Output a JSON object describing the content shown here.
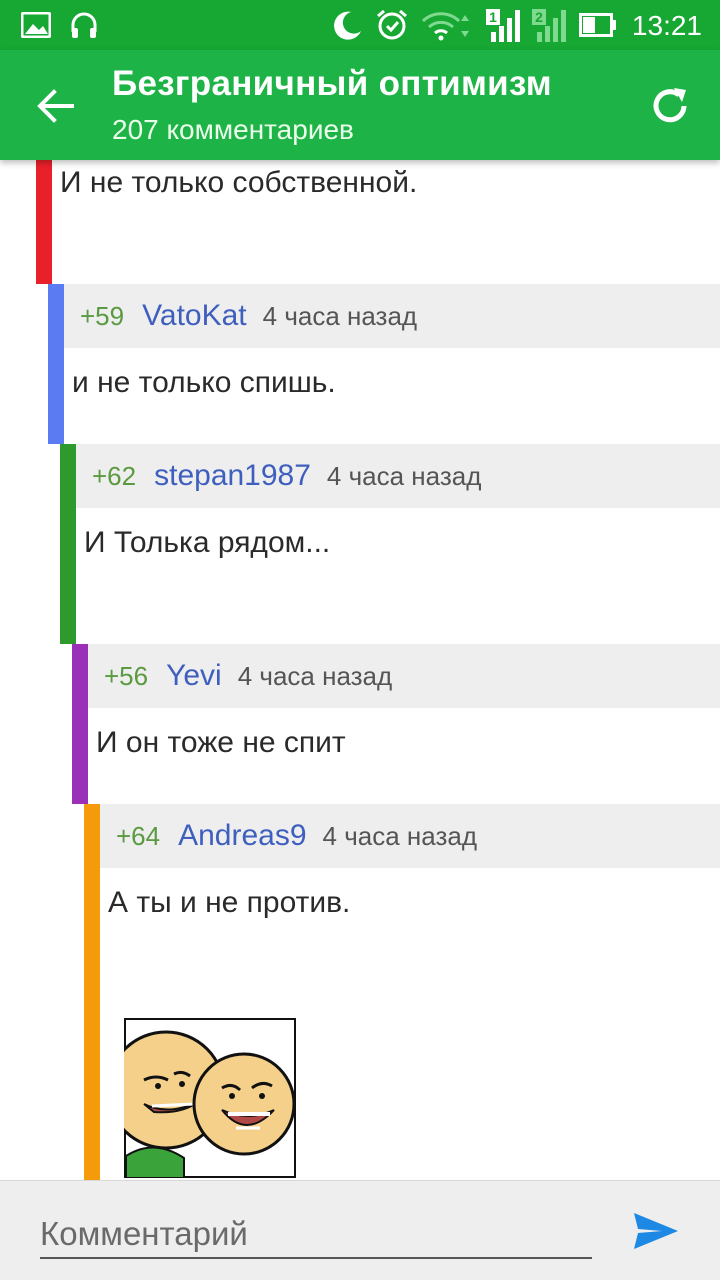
{
  "status_bar": {
    "time": "13:21",
    "icons": [
      "gallery-icon",
      "headphones-icon",
      "moon-icon",
      "alarm-icon",
      "wifi-icon",
      "signal-sim1-icon",
      "signal-sim2-icon",
      "battery-icon"
    ],
    "sim1_label": "1",
    "sim2_label": "2"
  },
  "app_bar": {
    "title": "Безграничный оптимизм",
    "subtitle": "207 комментариев",
    "color": "#1db347"
  },
  "comments": [
    {
      "text": "И не только собственной.",
      "bar_color": "#e8202a"
    },
    {
      "score": "+59",
      "author": "VatoKat",
      "time": "4 часа назад",
      "text": "и не только спишь.",
      "bar_color": "#5a7bf2"
    },
    {
      "score": "+62",
      "author": "stepan1987",
      "time": "4 часа назад",
      "text": "И Толька рядом...",
      "bar_color": "#2e9a2e"
    },
    {
      "score": "+56",
      "author": "Yevi",
      "time": "4 часа назад",
      "text": "И он тоже не спит",
      "bar_color": "#9b30b8"
    },
    {
      "score": "+64",
      "author": "Andreas9",
      "time": "4 часа назад",
      "text": "А ты и не против.",
      "bar_color": "#f59a0a",
      "image": "cyanide-happiness-meme"
    }
  ],
  "composer": {
    "placeholder": "Комментарий",
    "send_icon": "send-icon",
    "accent": "#1e88e5"
  }
}
